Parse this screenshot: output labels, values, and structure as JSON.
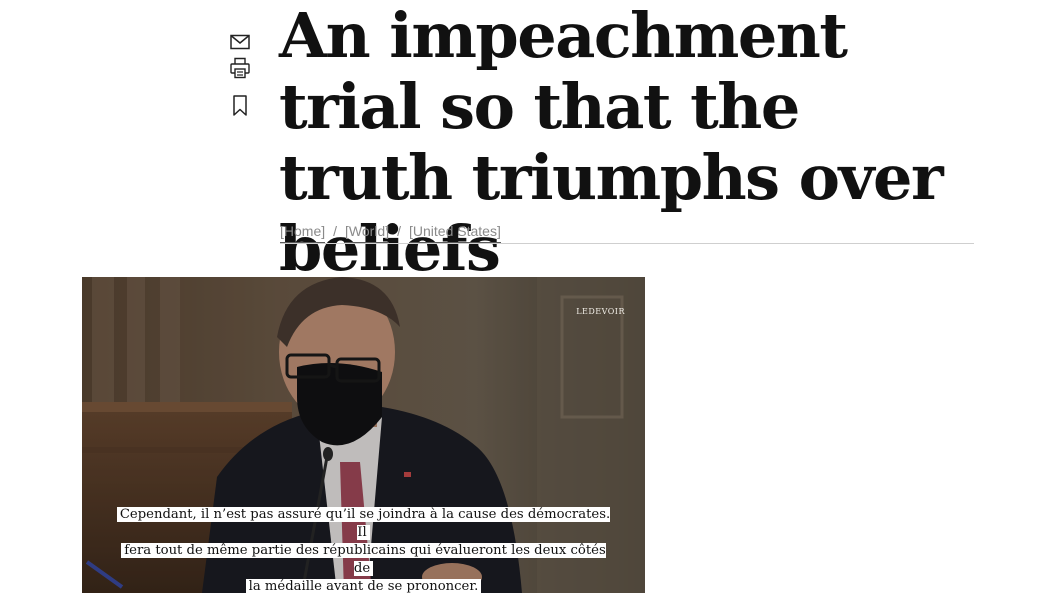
{
  "article": {
    "headline": "An impeachment trial so that the truth triumphs over beliefs"
  },
  "actions": {
    "mail_icon": "mail-icon",
    "print_icon": "print-icon",
    "bookmark_icon": "bookmark-icon"
  },
  "breadcrumb": {
    "items": [
      "[Home]",
      "[World]",
      "[United States]"
    ],
    "separator": "/"
  },
  "media": {
    "watermark": "LEDEVOIR",
    "caption_lines": [
      "Cependant, il n’est pas assuré qu’il se joindra à la cause des démocrates. Il",
      "fera tout de même partie des républicains qui évalueront les deux côtés de",
      "la médaille avant de se prononcer."
    ]
  }
}
